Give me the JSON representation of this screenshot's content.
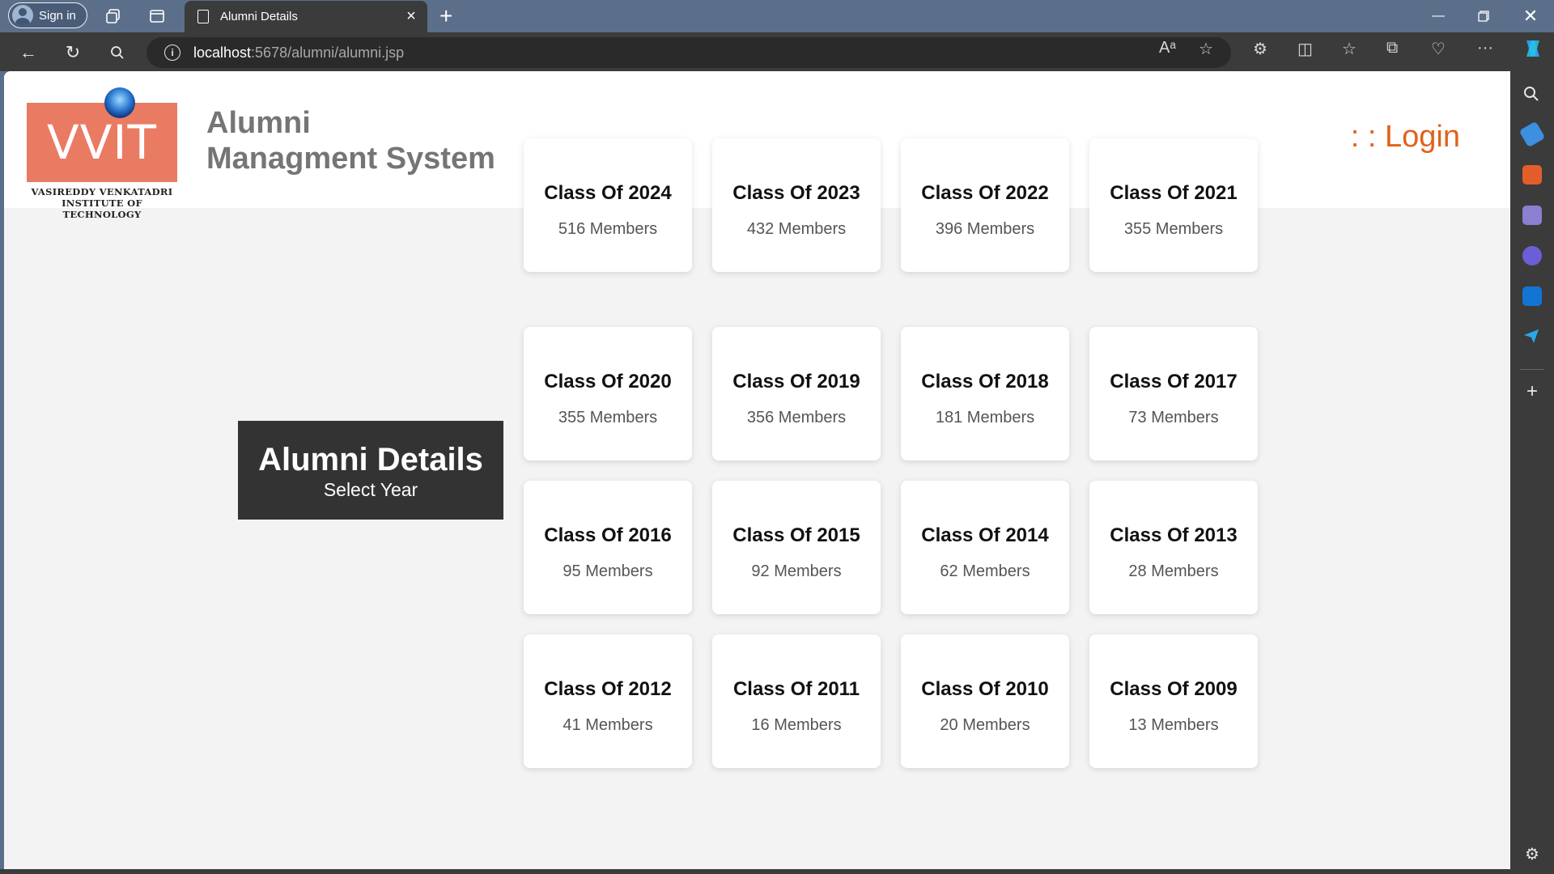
{
  "browser": {
    "sign_in_label": "Sign in",
    "tab_title": "Alumni Details",
    "url_host": "localhost",
    "url_path": ":5678/alumni/alumni.jsp"
  },
  "header": {
    "logo_text": "VVIT",
    "logo_line1": "VASIREDDY VENKATADRI",
    "logo_line2": "INSTITUTE OF TECHNOLOGY",
    "title_line1": "Alumni",
    "title_line2": "Managment System",
    "login_label": ": : Login"
  },
  "section": {
    "title": "Alumni Details",
    "subtitle": "Select Year"
  },
  "classes": [
    {
      "name": "Class Of 2024",
      "members": "516 Members"
    },
    {
      "name": "Class Of 2023",
      "members": "432 Members"
    },
    {
      "name": "Class Of 2022",
      "members": "396 Members"
    },
    {
      "name": "Class Of 2021",
      "members": "355 Members"
    },
    {
      "name": "Class Of 2020",
      "members": "355 Members"
    },
    {
      "name": "Class Of 2019",
      "members": "356 Members"
    },
    {
      "name": "Class Of 2018",
      "members": "181 Members"
    },
    {
      "name": "Class Of 2017",
      "members": "73 Members"
    },
    {
      "name": "Class Of 2016",
      "members": "95 Members"
    },
    {
      "name": "Class Of 2015",
      "members": "92 Members"
    },
    {
      "name": "Class Of 2014",
      "members": "62 Members"
    },
    {
      "name": "Class Of 2013",
      "members": "28 Members"
    },
    {
      "name": "Class Of 2012",
      "members": "41 Members"
    },
    {
      "name": "Class Of 2011",
      "members": "16 Members"
    },
    {
      "name": "Class Of 2010",
      "members": "20 Members"
    },
    {
      "name": "Class Of 2009",
      "members": "13 Members"
    }
  ],
  "colors": {
    "accent": "#e2611b",
    "logo": "#ea7b63",
    "section_bg": "#333333"
  }
}
